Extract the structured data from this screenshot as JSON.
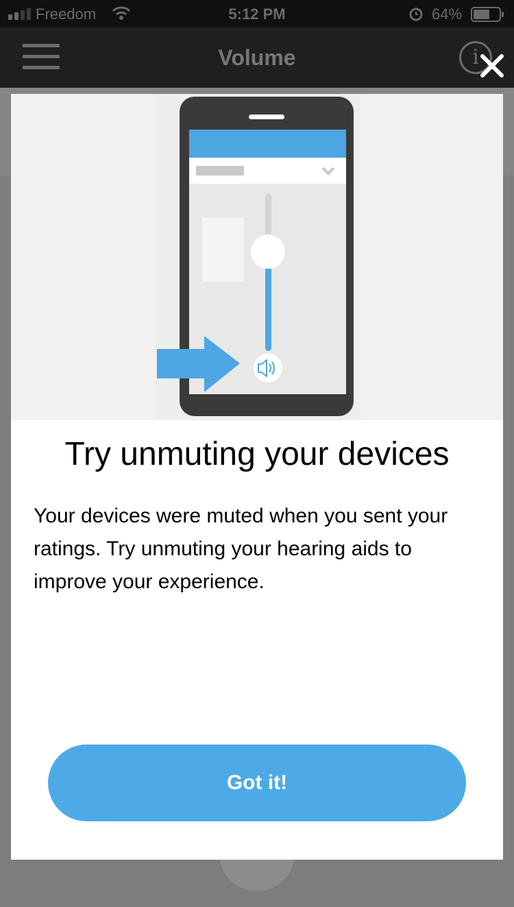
{
  "status_bar": {
    "carrier": "Freedom",
    "time": "5:12 PM",
    "battery_percent": "64%",
    "battery_level": 0.64,
    "icons": [
      "signal-icon",
      "wifi-icon",
      "alarm-icon",
      "battery-icon"
    ]
  },
  "nav": {
    "title": "Volume",
    "menu_icon": "hamburger-menu-icon",
    "info_icon_glyph": "i",
    "close_icon": "close-icon"
  },
  "modal": {
    "illustration": {
      "description_icons": [
        "phone-icon",
        "arrow-right-icon",
        "speaker-icon",
        "chevron-down-icon"
      ],
      "accent_color": "#4ea6e2"
    },
    "title": "Try unmuting your devices",
    "body": "Your devices were muted when you sent your ratings. Try unmuting your hearing aids to improve your experience.",
    "button_label": "Got it!"
  },
  "colors": {
    "accent": "#4eaae6",
    "overlay": "#7d7d7d",
    "nav_background": "#1f1f1f"
  }
}
